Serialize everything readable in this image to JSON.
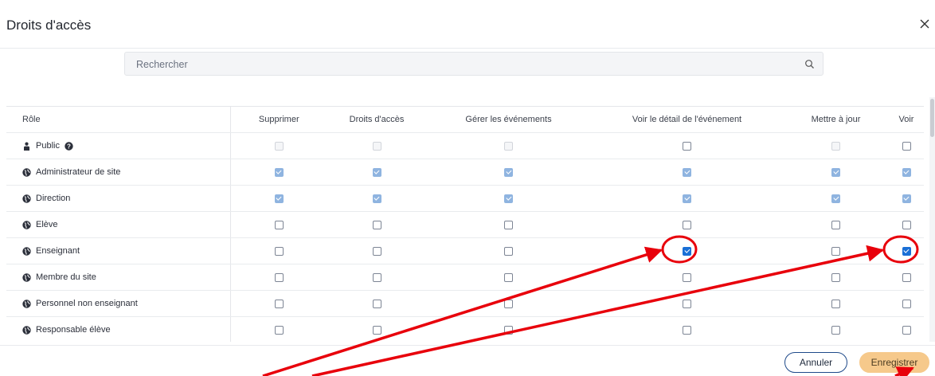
{
  "dialog": {
    "title": "Droits d'accès"
  },
  "search": {
    "placeholder": "Rechercher",
    "value": ""
  },
  "table": {
    "headers": [
      "Rôle",
      "Supprimer",
      "Droits d'accès",
      "Gérer les événements",
      "Voir le détail de l'événement",
      "Mettre à jour",
      "Voir"
    ],
    "rows": [
      {
        "role": "Public",
        "icon": "person-icon",
        "info": true,
        "states": [
          "disabled",
          "disabled",
          "disabled",
          "unchecked",
          "disabled",
          "unchecked"
        ]
      },
      {
        "role": "Administrateur de site",
        "icon": "globe-icon",
        "info": false,
        "states": [
          "checked-dim",
          "checked-dim",
          "checked-dim",
          "checked-dim",
          "checked-dim",
          "checked-dim"
        ]
      },
      {
        "role": "Direction",
        "icon": "globe-icon",
        "info": false,
        "states": [
          "checked-dim",
          "checked-dim",
          "checked-dim",
          "checked-dim",
          "checked-dim",
          "checked-dim"
        ]
      },
      {
        "role": "Elève",
        "icon": "globe-icon",
        "info": false,
        "states": [
          "unchecked",
          "unchecked",
          "unchecked",
          "unchecked",
          "unchecked",
          "unchecked"
        ]
      },
      {
        "role": "Enseignant",
        "icon": "globe-icon",
        "info": false,
        "states": [
          "unchecked",
          "unchecked",
          "unchecked",
          "checked",
          "unchecked",
          "checked"
        ]
      },
      {
        "role": "Membre du site",
        "icon": "globe-icon",
        "info": false,
        "states": [
          "unchecked",
          "unchecked",
          "unchecked",
          "unchecked",
          "unchecked",
          "unchecked"
        ]
      },
      {
        "role": "Personnel non enseignant",
        "icon": "globe-icon",
        "info": false,
        "states": [
          "unchecked",
          "unchecked",
          "unchecked",
          "unchecked",
          "unchecked",
          "unchecked"
        ]
      },
      {
        "role": "Responsable élève",
        "icon": "globe-icon",
        "info": false,
        "states": [
          "unchecked",
          "unchecked",
          "unchecked",
          "unchecked",
          "unchecked",
          "unchecked"
        ]
      }
    ]
  },
  "footer": {
    "cancel_label": "Annuler",
    "save_label": "Enregistrer"
  },
  "colors": {
    "accent_checked": "#1a6fd6",
    "checked_dimmed": "#8fb4e0",
    "save_button": "#f6c98b",
    "annotation_red": "#e8000b"
  },
  "icons": {
    "close": "close-icon",
    "search": "search-icon",
    "person": "person-icon",
    "globe": "globe-icon",
    "info": "info-icon"
  }
}
